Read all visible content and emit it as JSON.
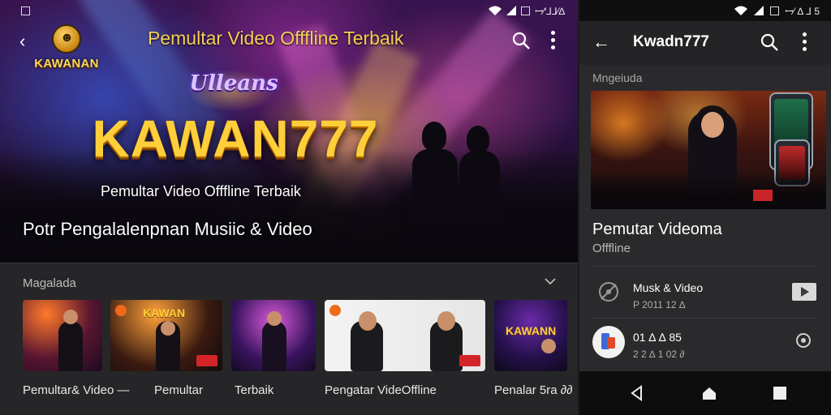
{
  "colors": {
    "accent_gold": "#f6cf58",
    "brand_gold": "#ffcf3a",
    "bg_dark": "#262628",
    "tag_red": "#d3242a"
  },
  "left": {
    "status": {
      "text": "ꟷ⁄ꞌ⅃⅃⁄∆ ",
      "icons": [
        "wifi-icon",
        "signal-icon",
        "battery-icon"
      ]
    },
    "topbar": {
      "back_icon": "chevron-left-icon",
      "logo_text": "KAWANAN",
      "title": "Pemultar Video Offfline Terbaik",
      "search_icon": "search-icon",
      "more_icon": "more-vert-icon"
    },
    "hero": {
      "script_text": "Ulleans",
      "brand": "KAWAN777",
      "subtitle": "Pemultar Video Offfline Terbaik",
      "caption": "Potr Pengalalenpnan Musiic & Video"
    },
    "section": {
      "title": "Magalada",
      "chevron_icon": "chevron-down-icon",
      "items": [
        {
          "caption": "Pemultar& Video —"
        },
        {
          "caption": "Pemultar",
          "thumb_text": "KAWAN"
        },
        {
          "caption": "Terbaik"
        },
        {
          "caption": "Pengatar VideOffline"
        },
        {
          "caption": "Penalar 5ra ∂∂",
          "thumb_text": "KAWANN"
        }
      ]
    }
  },
  "right": {
    "status_text": "ꟷ⁄ ∆ ⅃ 5",
    "topbar": {
      "back_icon": "arrow-left-icon",
      "title": "Kwadn777",
      "search_icon": "search-icon",
      "more_icon": "more-vert-icon"
    },
    "section_title": "Mngeiuda",
    "feature": {
      "title": "Pemutar Videoma",
      "subtitle": "Offfline"
    },
    "rows": [
      {
        "title": "Musk & Video",
        "subtitle": "P 2011 12 ∆",
        "icon": "music-disc-icon",
        "action_icon": "play-icon"
      },
      {
        "title": "01 ∆ ∆ 85",
        "subtitle": "2 2 ∆ 1 02 ∂",
        "icon": "app-logo-icon",
        "action_icon": "radio-button-icon"
      }
    ],
    "nav": [
      "back-triangle-icon",
      "home-icon",
      "recents-square-icon"
    ]
  }
}
